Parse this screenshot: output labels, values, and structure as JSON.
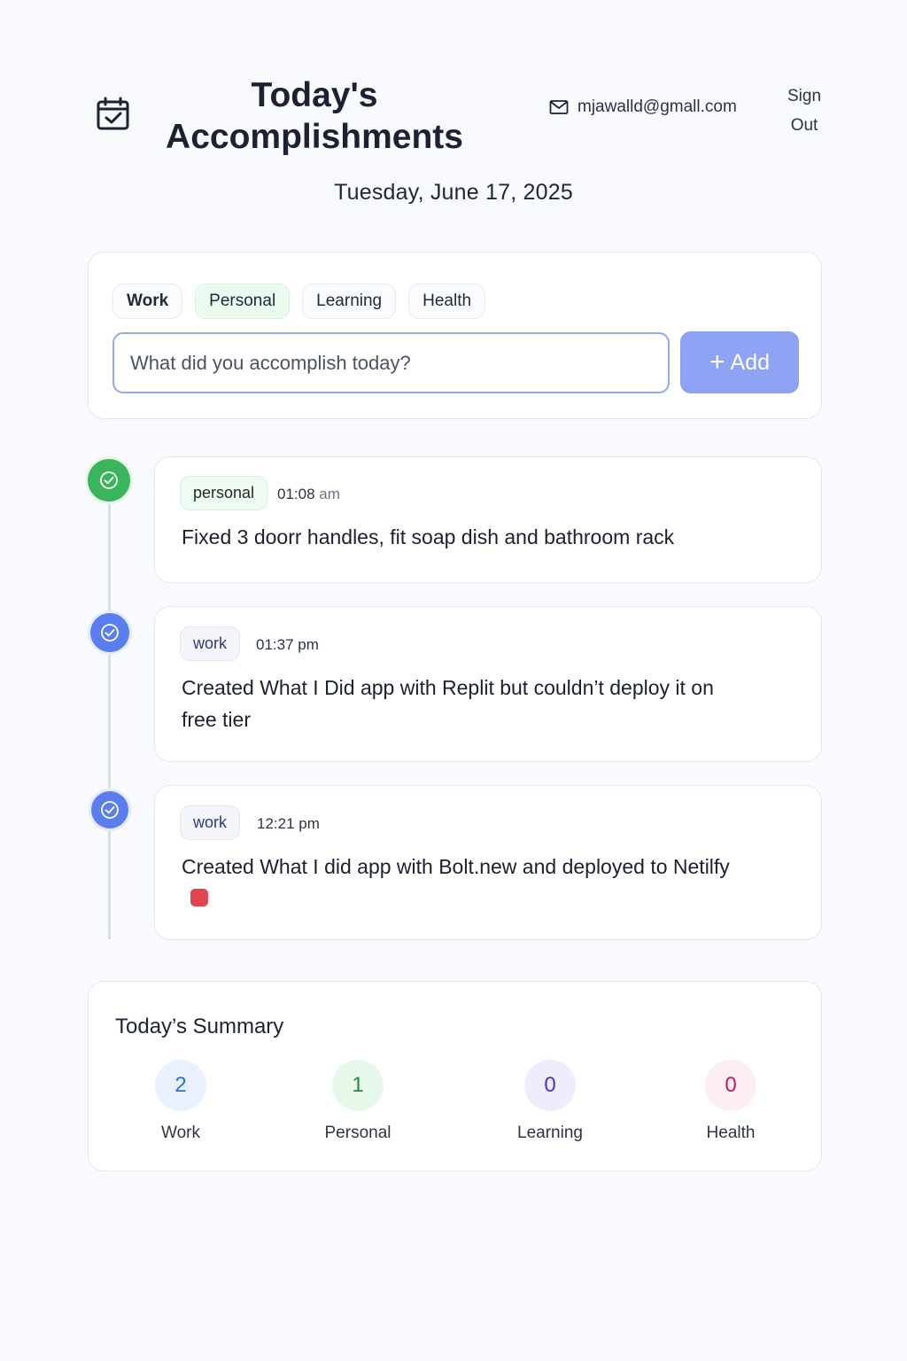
{
  "header": {
    "title": "Today's Accomplishments",
    "email": "mjawalld@gmall.com",
    "sign_out": "Sign Out",
    "date": "Tuesday, June 17, 2025"
  },
  "composer": {
    "categories": [
      "Work",
      "Personal",
      "Learning",
      "Health"
    ],
    "selected_category": "Personal",
    "placeholder": "What did you accomplish today?",
    "value": "",
    "add_label": "Add"
  },
  "entries": [
    {
      "category": "personal",
      "time": "01:08",
      "ampm": "am",
      "text": "Fixed 3 doorr handles, fit soap dish and bathroom rack",
      "status_color": "#3bb55c"
    },
    {
      "category": "work",
      "time": "01:37 pm",
      "ampm": "",
      "text": "Created What I Did app with Replit but couldn’t deploy it on free tier",
      "status_color": "#5a7df0"
    },
    {
      "category": "work",
      "time": "12:21 pm",
      "ampm": "",
      "text": "Created What I did app with Bolt.new and deployed to Netilfy",
      "status_color": "#5a7df0",
      "emoji": "red-emoji-icon"
    }
  ],
  "summary": {
    "title": "Today’s Summary",
    "stats": [
      {
        "label": "Work",
        "count": "2",
        "bg": "#e8f1fd",
        "fg": "#2f6fd6"
      },
      {
        "label": "Personal",
        "count": "1",
        "bg": "#e6f8ea",
        "fg": "#268a3e"
      },
      {
        "label": "Learning",
        "count": "0",
        "bg": "#f1ecfd",
        "fg": "#4a36b8"
      },
      {
        "label": "Health",
        "count": "0",
        "bg": "#fdeef5",
        "fg": "#b3245a"
      }
    ]
  },
  "colors": {
    "accent": "#8ea3f4",
    "input_border": "#93a8f1",
    "personal_green": "#3bb55c",
    "work_blue": "#5a7df0"
  }
}
